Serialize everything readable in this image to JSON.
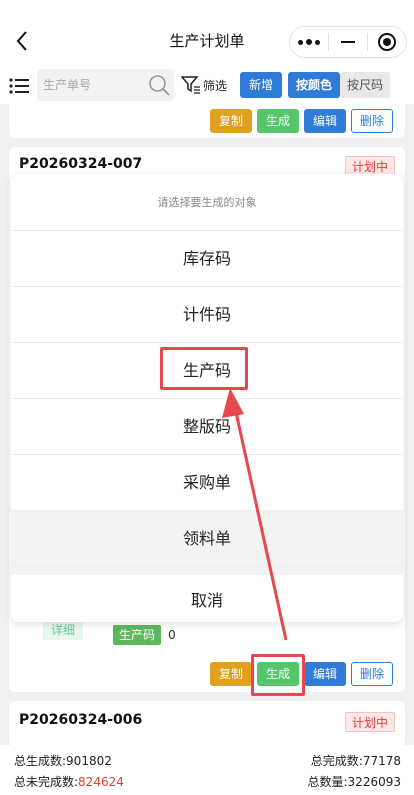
{
  "header": {
    "title": "生产计划单",
    "icons": [
      "back-icon",
      "more-dots-icon",
      "minimize-icon",
      "close-target-icon"
    ]
  },
  "toolbar": {
    "search_placeholder": "生产单号",
    "filter_label": "筛选",
    "new_label": "新增",
    "by_color_label": "按颜色",
    "by_size_label": "按尺码"
  },
  "cards": [
    {
      "actions": {
        "copy": "复制",
        "generate": "生成",
        "edit": "编辑",
        "delete": "删除"
      }
    },
    {
      "order_no": "P20260324-007",
      "status": "计划中",
      "detail": "详细",
      "code_label": "生产码",
      "code_count": "0",
      "actions": {
        "copy": "复制",
        "generate": "生成",
        "edit": "编辑",
        "delete": "删除"
      }
    },
    {
      "order_no": "P20260324-006",
      "status": "计划中"
    }
  ],
  "sheet": {
    "title": "请选择要生成的对象",
    "items": [
      "库存码",
      "计件码",
      "生产码",
      "整版码",
      "采购单",
      "领料单"
    ],
    "active_item": "领料单",
    "cancel": "取消"
  },
  "footer": {
    "total_generated": "总生成数:901802",
    "total_completed": "总完成数:77178",
    "total_incomplete_label": "总未完成数:",
    "total_incomplete_value": "824624",
    "total_quantity": "总数量:3226093"
  },
  "colors": {
    "accent_blue": "#2f7bd8",
    "generate_green": "#55c66a",
    "copy_orange": "#e0a020",
    "status_red": "#e0403c",
    "highlight_red": "#e5484d"
  }
}
